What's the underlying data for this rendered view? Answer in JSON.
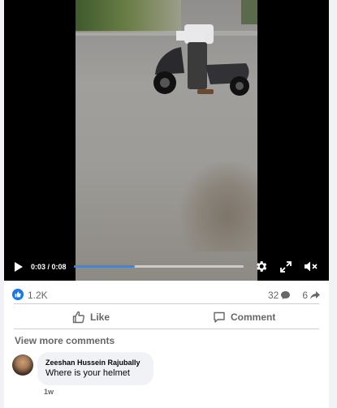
{
  "video": {
    "time_display": "0:03 / 0:08",
    "progress_fraction": 0.36
  },
  "stats": {
    "reactions_count": "1.2K",
    "comments_count": "32",
    "shares_count": "6"
  },
  "actions": {
    "like_label": "Like",
    "comment_label": "Comment"
  },
  "comments": {
    "view_more_label": "View more comments",
    "items": [
      {
        "author": "Zeeshan Hussein Rajubally",
        "text": "Where is your helmet",
        "time": "1w"
      }
    ]
  },
  "colors": {
    "accent": "#1877f2",
    "progress": "#2d88ff",
    "muted_text": "#65676b"
  }
}
